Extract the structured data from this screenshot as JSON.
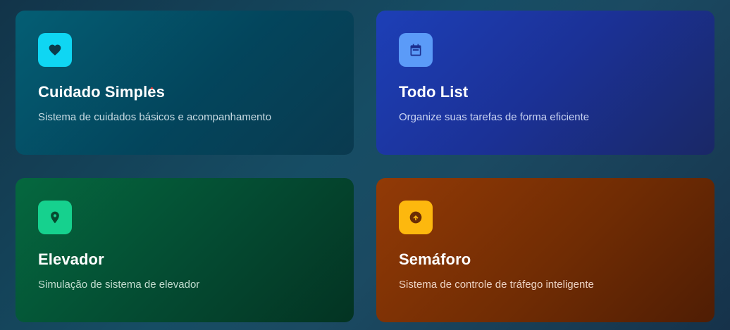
{
  "cards": [
    {
      "title": "Cuidado Simples",
      "description": "Sistema de cuidados básicos e acompanhamento",
      "icon": "heart-icon",
      "accent": "#0fd6f3"
    },
    {
      "title": "Todo List",
      "description": "Organize suas tarefas de forma eficiente",
      "icon": "calendar-icon",
      "accent": "#5b9bf8"
    },
    {
      "title": "Elevador",
      "description": "Simulação de sistema de elevador",
      "icon": "map-pin-icon",
      "accent": "#16d18e"
    },
    {
      "title": "Semáforo",
      "description": "Sistema de controle de tráfego inteligente",
      "icon": "arrow-up-circle-icon",
      "accent": "#fdb80e"
    }
  ]
}
